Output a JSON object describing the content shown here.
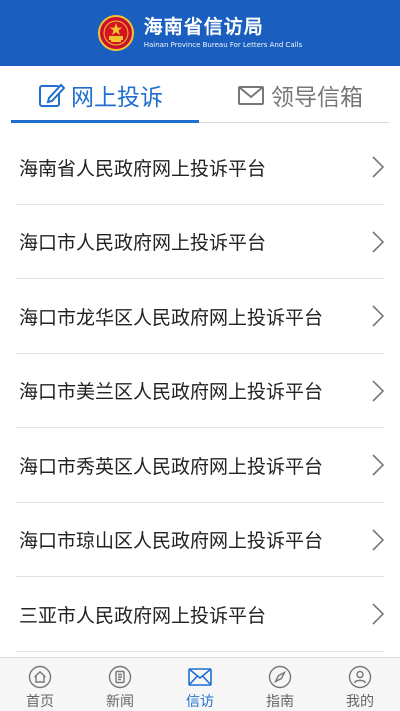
{
  "header": {
    "title": "海南省信访局",
    "subtitle": "Hainan Province Bureau For Letters And Calls",
    "emblem_icon": "national-emblem-icon"
  },
  "tabs": [
    {
      "label": "网上投诉",
      "icon": "edit-icon",
      "active": true
    },
    {
      "label": "领导信箱",
      "icon": "mail-icon",
      "active": false
    }
  ],
  "colors": {
    "header_bg": "#1a5fbf",
    "accent": "#1f6fce"
  },
  "list": {
    "items": [
      {
        "label": "海南省人民政府网上投诉平台"
      },
      {
        "label": "海口市人民政府网上投诉平台"
      },
      {
        "label": "海口市龙华区人民政府网上投诉平台"
      },
      {
        "label": "海口市美兰区人民政府网上投诉平台"
      },
      {
        "label": "海口市秀英区人民政府网上投诉平台"
      },
      {
        "label": "海口市琼山区人民政府网上投诉平台"
      },
      {
        "label": "三亚市人民政府网上投诉平台"
      }
    ]
  },
  "bottom_nav": [
    {
      "label": "首页",
      "icon": "home-icon",
      "active": false
    },
    {
      "label": "新闻",
      "icon": "news-icon",
      "active": false
    },
    {
      "label": "信访",
      "icon": "letter-icon",
      "active": true
    },
    {
      "label": "指南",
      "icon": "compass-icon",
      "active": false
    },
    {
      "label": "我的",
      "icon": "user-icon",
      "active": false
    }
  ]
}
